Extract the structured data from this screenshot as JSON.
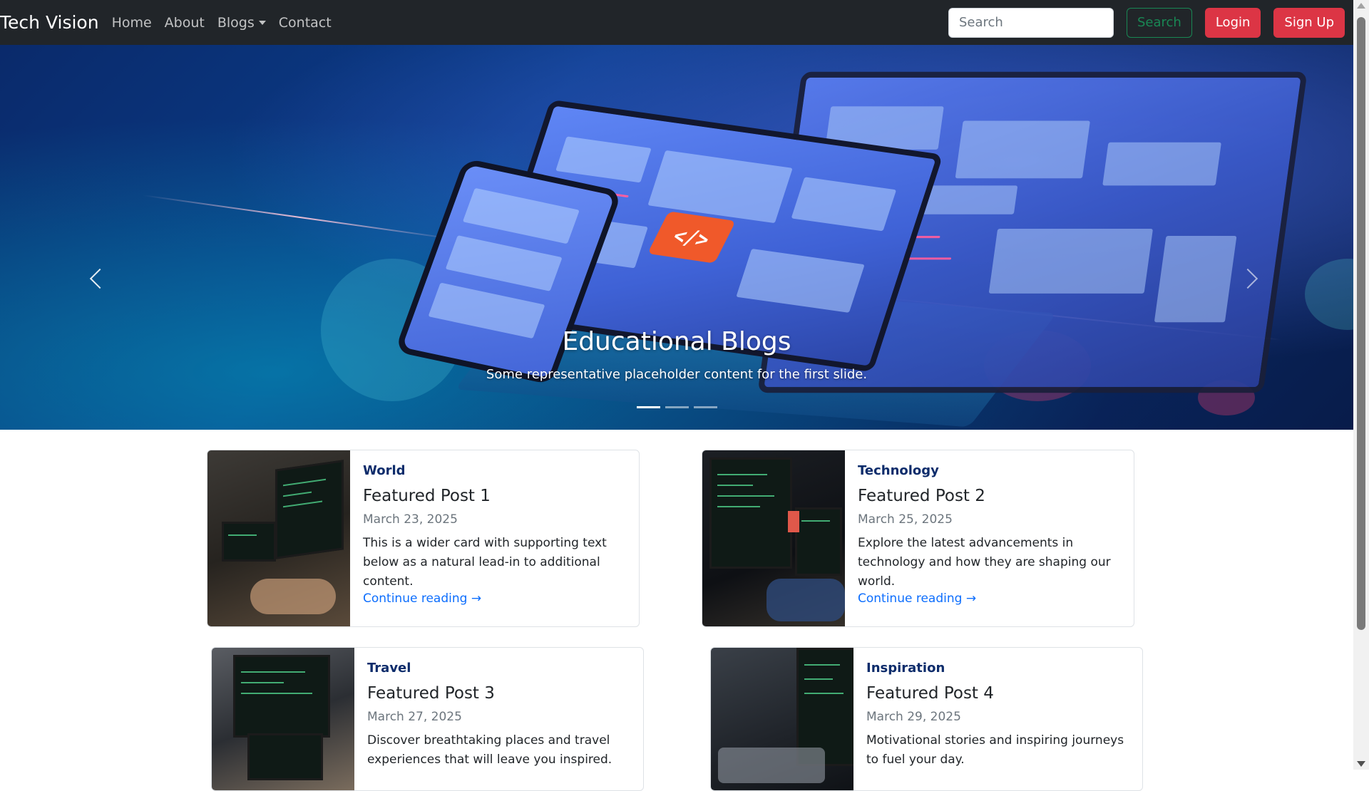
{
  "navbar": {
    "brand": "Tech Vision",
    "links": [
      "Home",
      "About",
      "Blogs",
      "Contact"
    ],
    "search_placeholder": "Search",
    "search_button": "Search",
    "login_button": "Login",
    "signup_button": "Sign Up"
  },
  "hero": {
    "title": "Educational Blogs",
    "subtitle": "Some representative placeholder content for the first slide.",
    "badge_text": "</>",
    "slides_count": 3,
    "active_slide": 1
  },
  "cards": [
    {
      "category": "World",
      "title": "Featured Post 1",
      "date": "March 23, 2025",
      "text": "This is a wider card with supporting text below as a natural lead-in to additional content.",
      "link": "Continue reading →"
    },
    {
      "category": "Technology",
      "title": "Featured Post 2",
      "date": "March 25, 2025",
      "text": "Explore the latest advancements in technology and how they are shaping our world.",
      "link": "Continue reading →"
    },
    {
      "category": "Travel",
      "title": "Featured Post 3",
      "date": "March 27, 2025",
      "text": "Discover breathtaking places and travel experiences that will leave you inspired.",
      "link": ""
    },
    {
      "category": "Inspiration",
      "title": "Featured Post 4",
      "date": "March 29, 2025",
      "text": "Motivational stories and inspiring journeys to fuel your day.",
      "link": ""
    }
  ],
  "colors": {
    "navbar_bg": "#212529",
    "danger": "#dc3545",
    "success": "#198754",
    "link": "#0d6efd",
    "category": "#0d2c6b"
  },
  "icons": {
    "carousel_prev": "chevron-left-icon",
    "carousel_next": "chevron-right-icon",
    "dropdown": "caret-down-icon"
  }
}
